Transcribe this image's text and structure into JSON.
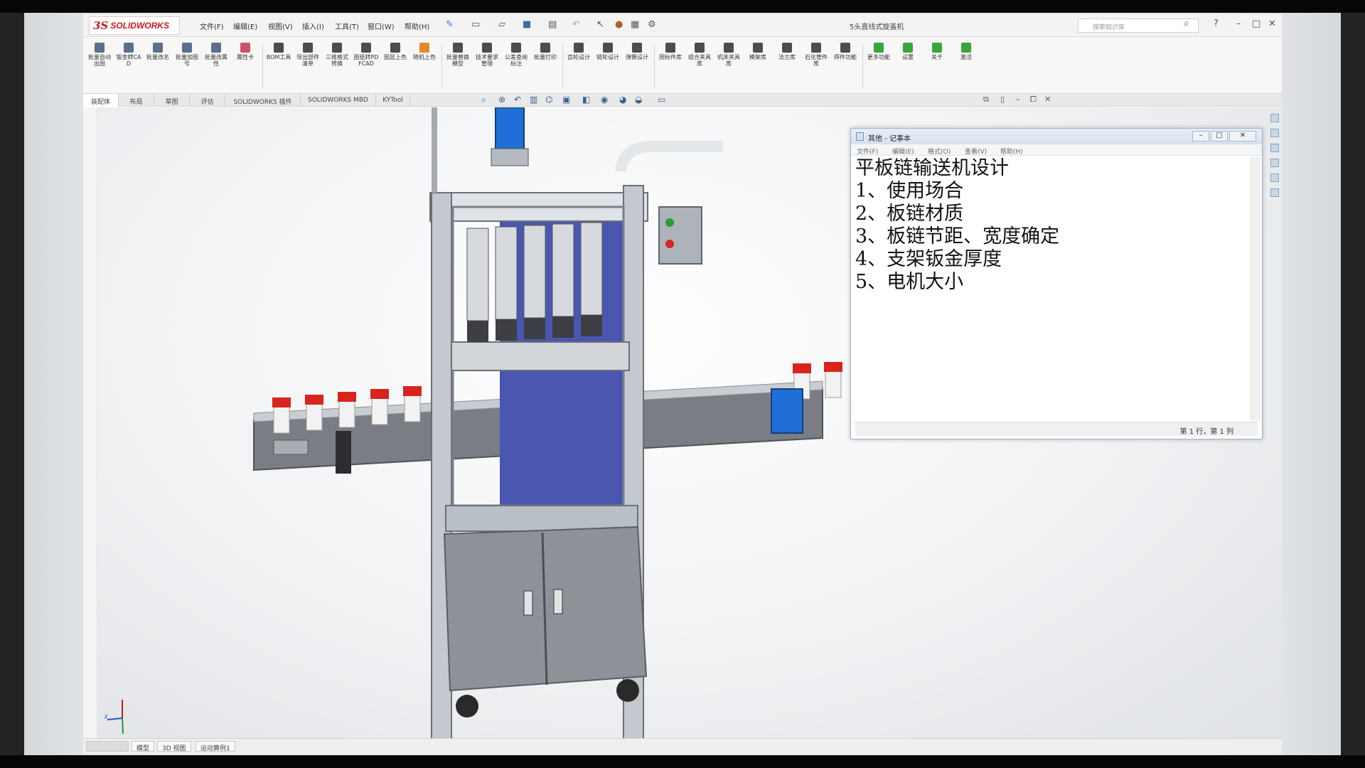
{
  "app": {
    "logo_mark": "3S",
    "logo_name": "SOLIDWORKS",
    "menus": [
      "文件(F)",
      "编辑(E)",
      "视图(V)",
      "插入(I)",
      "工具(T)",
      "窗口(W)",
      "帮助(H)"
    ],
    "document_title": "5头直线式旋盖机",
    "search_placeholder": "搜索知识库"
  },
  "ribbon": {
    "buttons": [
      {
        "label": "批量自动出图",
        "color": "#5a6f8c"
      },
      {
        "label": "钣金转CAD",
        "color": "#5a6f8c"
      },
      {
        "label": "批量改名",
        "color": "#5a6f8c"
      },
      {
        "label": "批量加图号",
        "color": "#5a6f8c"
      },
      {
        "label": "批量改属性",
        "color": "#5a6f8c"
      },
      {
        "label": "属性卡",
        "color": "#d0506a"
      },
      {
        "label": "BOM工具",
        "color": "#4d4d4d"
      },
      {
        "label": "导出部件清单",
        "color": "#4d4d4d"
      },
      {
        "label": "三维格式转换",
        "color": "#4d4d4d"
      },
      {
        "label": "图纸转PDFCAD",
        "color": "#4d4d4d"
      },
      {
        "label": "图层上色",
        "color": "#4d4d4d"
      },
      {
        "label": "随机上色",
        "color": "#e08a2a"
      },
      {
        "label": "批量替换模型",
        "color": "#4d4d4d"
      },
      {
        "label": "技术要求管理",
        "color": "#4d4d4d"
      },
      {
        "label": "公差查询标注",
        "color": "#4d4d4d"
      },
      {
        "label": "批量打印",
        "color": "#4d4d4d"
      },
      {
        "label": "齿轮设计",
        "color": "#4d4d4d"
      },
      {
        "label": "链轮设计",
        "color": "#4d4d4d"
      },
      {
        "label": "弹簧设计",
        "color": "#4d4d4d"
      },
      {
        "label": "国标件库",
        "color": "#4d4d4d"
      },
      {
        "label": "组合夹具库",
        "color": "#4d4d4d"
      },
      {
        "label": "机床夹具库",
        "color": "#4d4d4d"
      },
      {
        "label": "模架库",
        "color": "#4d4d4d"
      },
      {
        "label": "法兰库",
        "color": "#4d4d4d"
      },
      {
        "label": "石化管件库",
        "color": "#4d4d4d"
      },
      {
        "label": "焊件功能",
        "color": "#4d4d4d"
      },
      {
        "label": "更多功能",
        "color": "#3aa63a"
      },
      {
        "label": "设置",
        "color": "#3aa63a"
      },
      {
        "label": "关于",
        "color": "#3aa63a"
      },
      {
        "label": "激活",
        "color": "#3aa63a"
      }
    ]
  },
  "tabs": [
    "装配体",
    "布局",
    "草图",
    "评估",
    "SOLIDWORKS 插件",
    "SOLIDWORKS MBD",
    "KYTool"
  ],
  "bottom_tabs": [
    "",
    "模型",
    "3D 视图",
    "运动算例1"
  ],
  "notepad": {
    "title": "其他 - 记事本",
    "menus": [
      "文件(F)",
      "编辑(E)",
      "格式(O)",
      "查看(V)",
      "帮助(H)"
    ],
    "lines": [
      "平板链输送机设计",
      "1、使用场合",
      "2、板链材质",
      "3、板链节距、宽度确定",
      "4、支架钣金厚度",
      "5、电机大小"
    ],
    "status": "第 1 行，第 1 列"
  },
  "colors": {
    "brand": "#c8191e",
    "machine_frame": "#b9bfc6",
    "machine_panel": "#4a56b0",
    "motor_blue": "#1f6fd6",
    "bottle_cap_red": "#d9241d"
  }
}
